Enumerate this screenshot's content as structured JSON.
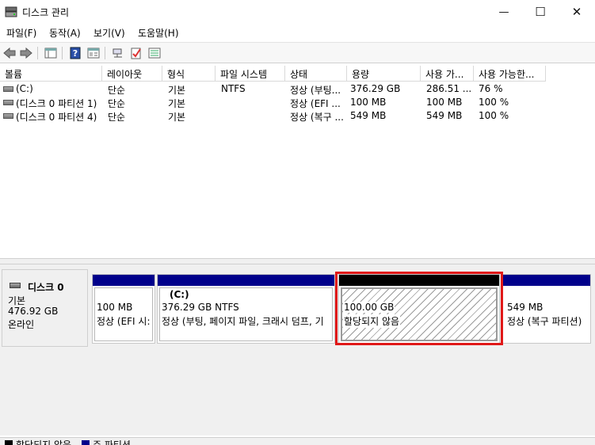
{
  "window": {
    "title": "디스크 관리",
    "minimize_glyph": "—",
    "maximize_glyph": "☐",
    "close_glyph": "✕"
  },
  "menu": [
    "파일(F)",
    "동작(A)",
    "보기(V)",
    "도움말(H)"
  ],
  "toolbar": {
    "icons": [
      "back-arrow-icon",
      "forward-arrow-icon",
      "console-tree-icon",
      "help-icon",
      "properties-icon",
      "connect-icon",
      "checklist-icon",
      "details-icon"
    ]
  },
  "volume_list": {
    "columns": [
      "볼륨",
      "레이아웃",
      "형식",
      "파일 시스템",
      "상태",
      "용량",
      "사용 가...",
      "사용 가능한..."
    ],
    "rows": [
      {
        "volume": "(C:)",
        "layout": "단순",
        "type": "기본",
        "fs": "NTFS",
        "status": "정상 (부팅...",
        "capacity": "376.29 GB",
        "free": "286.51 ...",
        "pct": "76 %"
      },
      {
        "volume": "(디스크 0 파티션 1)",
        "layout": "단순",
        "type": "기본",
        "fs": "",
        "status": "정상 (EFI ...",
        "capacity": "100 MB",
        "free": "100 MB",
        "pct": "100 %"
      },
      {
        "volume": "(디스크 0 파티션 4)",
        "layout": "단순",
        "type": "기본",
        "fs": "",
        "status": "정상 (복구 ...",
        "capacity": "549 MB",
        "free": "549 MB",
        "pct": "100 %"
      }
    ]
  },
  "disk0": {
    "name": "디스크 0",
    "type": "기본",
    "size": "476.92 GB",
    "state": "온라인",
    "partitions": [
      {
        "line1": "100 MB",
        "line2": "정상 (EFI 시:"
      },
      {
        "line1": "(C:)",
        "line2": "376.29 GB NTFS",
        "line3": "정상 (부팅, 페이지 파일, 크래시 덤프, 기"
      },
      {
        "line1": "100.00 GB",
        "line2": "할당되지 않음"
      },
      {
        "line1": "549 MB",
        "line2": "정상 (복구 파티션)"
      }
    ]
  },
  "legend": {
    "unallocated": "할당되지 않음",
    "primary": "주 파티션"
  },
  "colors": {
    "primary": "#00008b",
    "unallocated": "#000000",
    "highlight": "#e01818"
  }
}
